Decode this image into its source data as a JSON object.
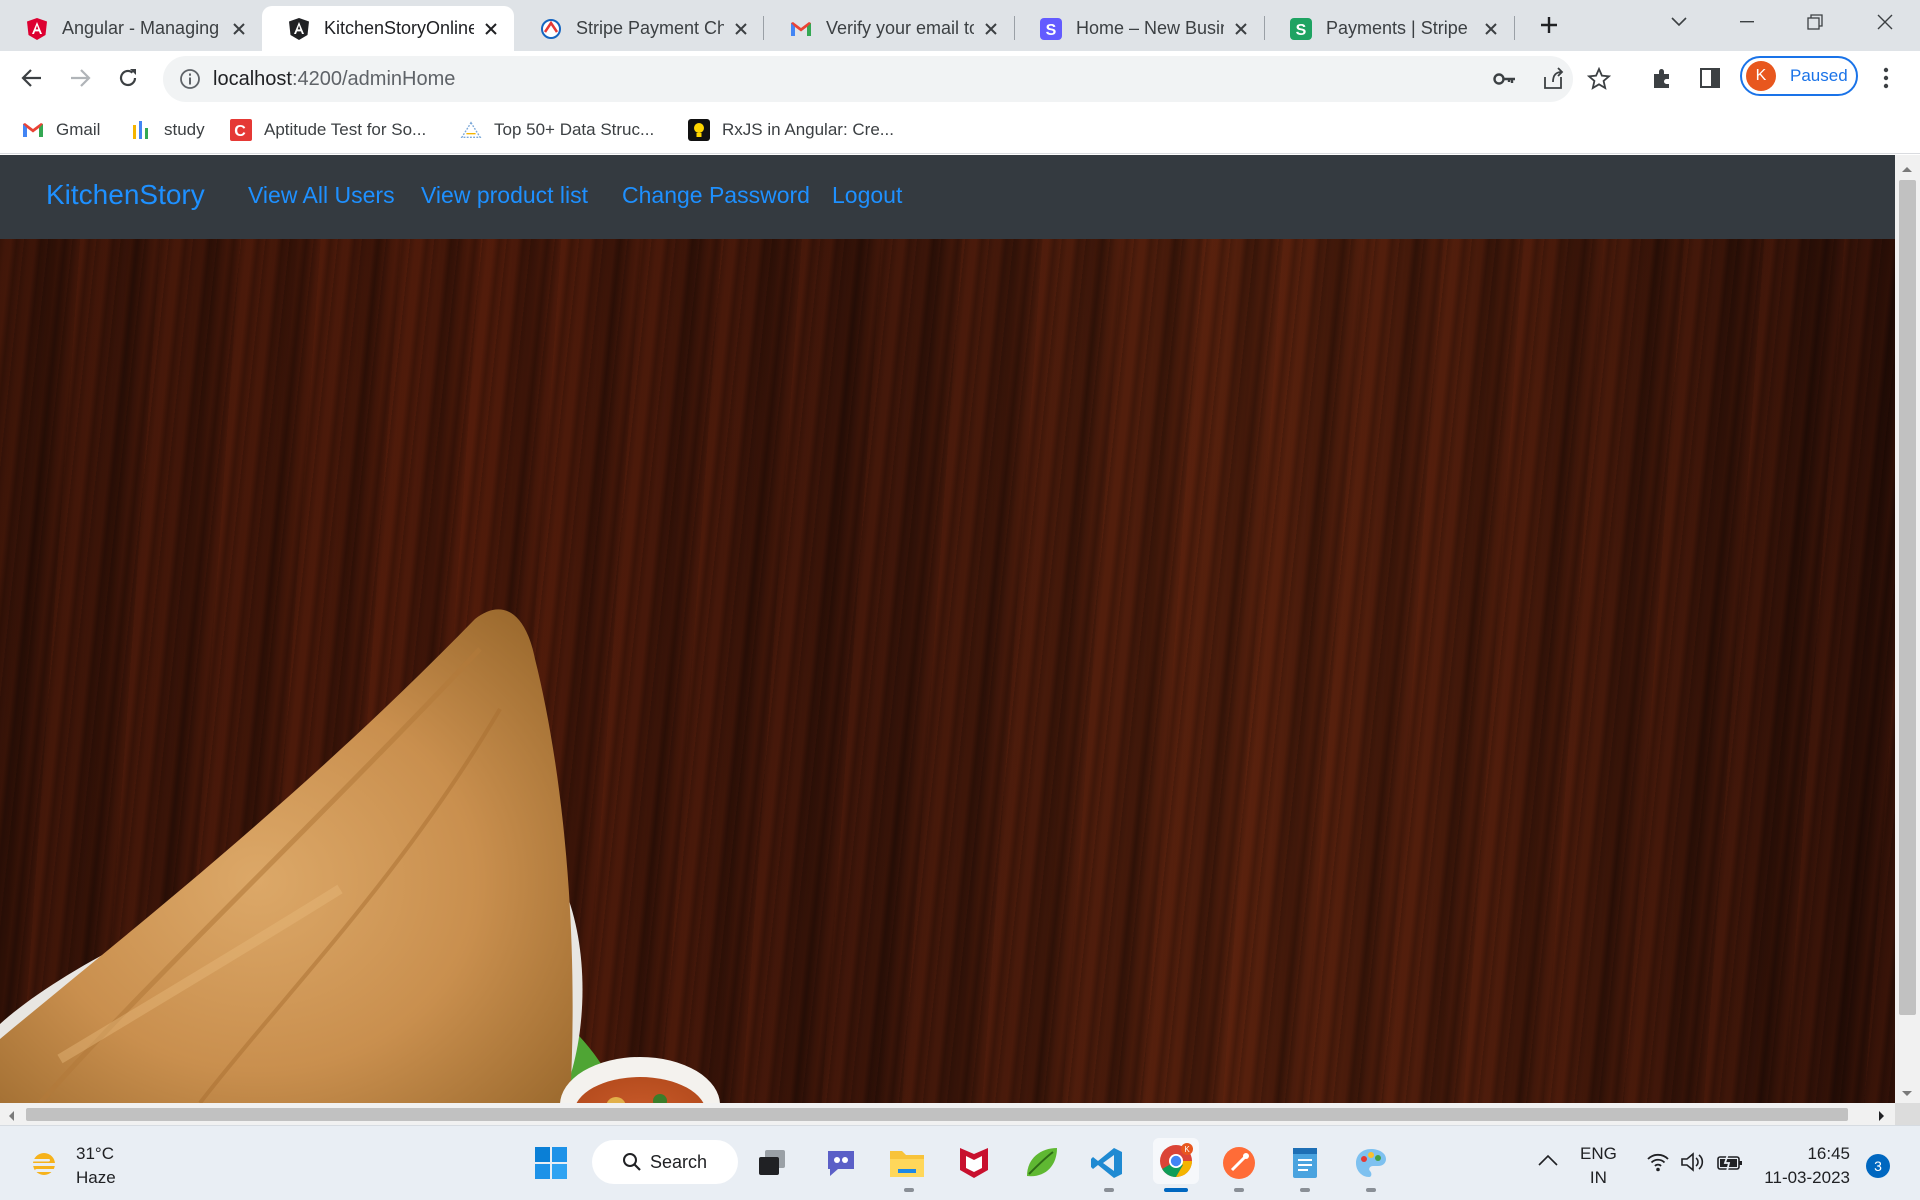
{
  "browser": {
    "tabs": [
      {
        "title": "Angular - Managing",
        "icon": "angular-red-icon",
        "active": false
      },
      {
        "title": "KitchenStoryOnline",
        "icon": "angular-black-icon",
        "active": true
      },
      {
        "title": "Stripe Payment Che",
        "icon": "payment-logo-icon",
        "active": false
      },
      {
        "title": "Verify your email to",
        "icon": "gmail-icon",
        "active": false
      },
      {
        "title": "Home – New Busine",
        "icon": "stripe-purple-icon",
        "active": false
      },
      {
        "title": "Payments | Stripe D",
        "icon": "stripe-green-icon",
        "active": false
      }
    ],
    "address": {
      "host": "localhost",
      "path": ":4200/adminHome"
    },
    "profile": {
      "initial": "K",
      "status": "Paused"
    },
    "bookmarks": [
      {
        "label": "Gmail",
        "icon": "gmail-icon"
      },
      {
        "label": "study",
        "icon": "study-bars-icon"
      },
      {
        "label": "Aptitude Test for So...",
        "icon": "c-logo-icon"
      },
      {
        "label": "Top 50+ Data Struc...",
        "icon": "pyramid-icon"
      },
      {
        "label": "RxJS in Angular: Cre...",
        "icon": "bulb-icon"
      }
    ]
  },
  "app": {
    "brand": "KitchenStory",
    "nav": [
      "View All Users",
      "View product list",
      "Change Password",
      "Logout"
    ],
    "colors": {
      "navbar_bg": "#343a40",
      "link": "#1e90ff",
      "hero_wood": "#4a1b0b"
    }
  },
  "taskbar": {
    "weather": {
      "temp": "31°C",
      "condition": "Haze"
    },
    "search_label": "Search",
    "apps": [
      "windows-start-icon",
      "task-view-icon",
      "teams-chat-icon",
      "file-explorer-icon",
      "mcafee-icon",
      "spring-tool-icon",
      "vscode-icon",
      "chrome-icon",
      "postman-icon",
      "notepad-icon",
      "paint-icon"
    ],
    "language": {
      "line1": "ENG",
      "line2": "IN"
    },
    "clock": {
      "time": "16:45",
      "date": "11-03-2023"
    },
    "notifications": "3"
  }
}
